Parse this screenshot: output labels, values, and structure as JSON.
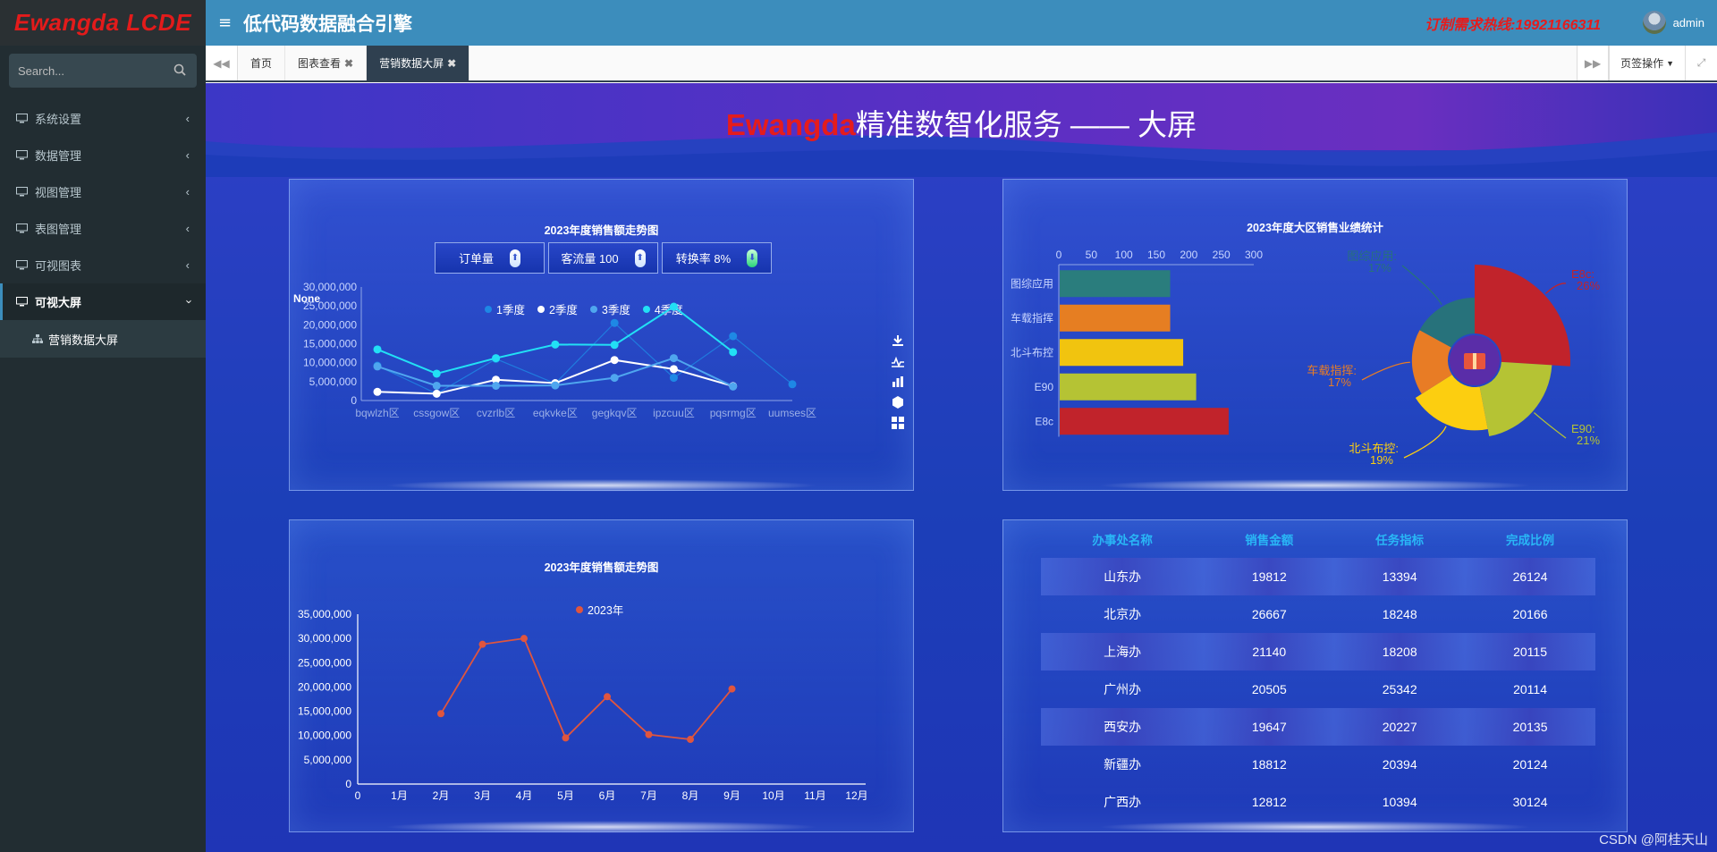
{
  "app": {
    "logo": "Ewangda LCDE",
    "title": "低代码数据融合引擎",
    "hotline": "订制需求热线:19921166311",
    "user": "admin"
  },
  "search": {
    "placeholder": "Search..."
  },
  "sidebar": {
    "items": [
      {
        "label": "系统设置"
      },
      {
        "label": "数据管理"
      },
      {
        "label": "视图管理"
      },
      {
        "label": "表图管理"
      },
      {
        "label": "可视图表"
      },
      {
        "label": "可视大屏"
      }
    ],
    "sub_items": [
      {
        "label": "营销数据大屏"
      }
    ]
  },
  "tabs": [
    {
      "label": "首页"
    },
    {
      "label": "图表查看"
    },
    {
      "label": "营销数据大屏"
    }
  ],
  "page_ops": "页签操作",
  "screen": {
    "brand": "Ewangda",
    "title_rest": "精准数智化服务 —— 大屏"
  },
  "panel1": {
    "title": "2023年度销售额走势图",
    "kpis": [
      {
        "label": "订单量"
      },
      {
        "label": "客流量 100"
      },
      {
        "label": "转换率 8%"
      }
    ],
    "none_label": "None"
  },
  "panel2": {
    "title": "2023年度大区销售业绩统计"
  },
  "panel3": {
    "title": "2023年度销售额走势图"
  },
  "table": {
    "headers": [
      "办事处名称",
      "销售金额",
      "任务指标",
      "完成比例"
    ],
    "rows": [
      [
        "山东办",
        "19812",
        "13394",
        "26124"
      ],
      [
        "北京办",
        "26667",
        "18248",
        "20166"
      ],
      [
        "上海办",
        "21140",
        "18208",
        "20115"
      ],
      [
        "广州办",
        "20505",
        "25342",
        "20114"
      ],
      [
        "西安办",
        "19647",
        "20227",
        "20135"
      ],
      [
        "新疆办",
        "18812",
        "20394",
        "20124"
      ],
      [
        "广西办",
        "12812",
        "10394",
        "30124"
      ]
    ]
  },
  "watermark": "CSDN @阿桂天山",
  "chart_data": [
    {
      "type": "line",
      "title": "2023年度销售额走势图",
      "categories": [
        "bqwlzh区",
        "cssgow区",
        "cvzrlb区",
        "eqkvke区",
        "gegkqv区",
        "ipzcuu区",
        "pqsrmg区",
        "uumses区"
      ],
      "ylim": [
        0,
        30000000
      ],
      "yticks": [
        0,
        5000000,
        10000000,
        15000000,
        20000000,
        25000000,
        30000000
      ],
      "ytick_labels": [
        "0",
        "5,000,000",
        "10,000,000",
        "15,000,000",
        "20,000,000",
        "25,000,000",
        "30,000,000"
      ],
      "series": [
        {
          "name": "1季度",
          "color": "#1e88e5",
          "values": [
            9200000,
            1800000,
            11000000,
            4500000,
            20500000,
            6000000,
            17000000,
            4300000
          ]
        },
        {
          "name": "2季度",
          "color": "#ffffff",
          "values": [
            2300000,
            1800000,
            5500000,
            4600000,
            10700000,
            8300000,
            3800000,
            null
          ]
        },
        {
          "name": "3季度",
          "color": "#4fa6ef",
          "values": [
            9000000,
            3900000,
            3900000,
            4000000,
            6000000,
            11200000,
            3700000,
            null
          ]
        },
        {
          "name": "4季度",
          "color": "#22e0f5",
          "values": [
            13500000,
            7100000,
            11200000,
            14800000,
            14700000,
            24800000,
            12800000,
            null
          ]
        }
      ]
    },
    {
      "type": "bar",
      "title": "2023年度大区销售业绩统计",
      "orientation": "horizontal",
      "categories": [
        "图综应用",
        "车载指挥",
        "北斗布控",
        "E90",
        "E8c"
      ],
      "values": [
        170,
        170,
        190,
        210,
        260
      ],
      "colors": [
        "#2a7d7d",
        "#e67e22",
        "#f1c40f",
        "#b5c334",
        "#c1232b"
      ],
      "xlim": [
        0,
        300
      ],
      "xticks": [
        0,
        50,
        100,
        150,
        200,
        250,
        300
      ]
    },
    {
      "type": "pie",
      "style": "rose",
      "slices": [
        {
          "label": "E8c",
          "percent": 26,
          "color": "#c1232b"
        },
        {
          "label": "E90",
          "percent": 21,
          "color": "#b5c334"
        },
        {
          "label": "北斗布控",
          "percent": 19,
          "color": "#fcce10"
        },
        {
          "label": "车载指挥",
          "percent": 17,
          "color": "#e87c25"
        },
        {
          "label": "图综应用",
          "percent": 17,
          "color": "#27727b"
        }
      ]
    },
    {
      "type": "line",
      "title": "2023年度销售额走势图",
      "categories": [
        "0",
        "1月",
        "2月",
        "3月",
        "4月",
        "5月",
        "6月",
        "7月",
        "8月",
        "9月",
        "10月",
        "11月",
        "12月"
      ],
      "ylim": [
        0,
        35000000
      ],
      "yticks": [
        0,
        5000000,
        10000000,
        15000000,
        20000000,
        25000000,
        30000000,
        35000000
      ],
      "ytick_labels": [
        "0",
        "5,000,000",
        "10,000,000",
        "15,000,000",
        "20,000,000",
        "25,000,000",
        "30,000,000",
        "35,000,000"
      ],
      "series": [
        {
          "name": "2023年",
          "color": "#e0553e",
          "values": [
            null,
            null,
            14500000,
            28800000,
            30000000,
            9500000,
            18000000,
            10200000,
            9200000,
            19600000,
            null,
            null,
            null
          ]
        }
      ]
    }
  ]
}
